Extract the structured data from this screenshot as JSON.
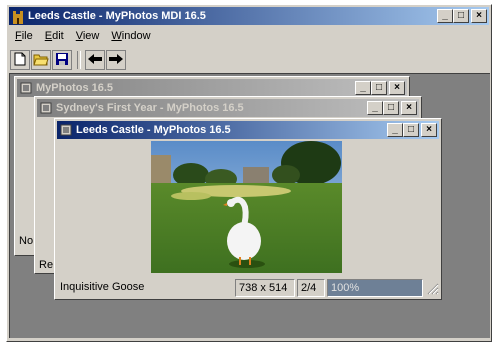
{
  "app": {
    "title": "Leeds Castle - MyPhotos MDI 16.5"
  },
  "menu": {
    "items": [
      {
        "first": "F",
        "rest": "ile"
      },
      {
        "first": "E",
        "rest": "dit"
      },
      {
        "first": "V",
        "rest": "iew"
      },
      {
        "first": "W",
        "rest": "indow"
      }
    ]
  },
  "toolbar": {
    "buttons": [
      "new-icon",
      "open-folder-icon",
      "save-icon",
      "back-arrow-icon",
      "forward-arrow-icon"
    ]
  },
  "windows": [
    {
      "title": "MyPhotos 16.5",
      "status_text": "No"
    },
    {
      "title": "Sydney's First Year - MyPhotos 16.5",
      "status_text": "Re"
    },
    {
      "title": "Leeds Castle - MyPhotos 16.5",
      "status": {
        "caption": "Inquisitive Goose",
        "dimensions": "738 x 514",
        "position": "2/4",
        "zoom": "100%"
      }
    }
  ],
  "caption_buttons": {
    "minimize": "_",
    "maximize": "□",
    "close": "×"
  },
  "colors": {
    "active_title_start": "#0a246a",
    "active_title_end": "#a6caf0",
    "inactive_title": "#808080",
    "progress": "#6e8096"
  }
}
